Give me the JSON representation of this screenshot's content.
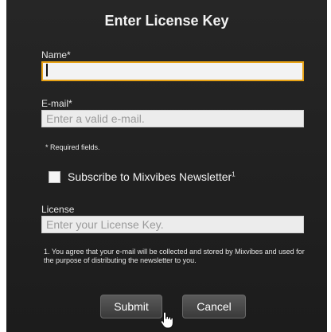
{
  "dialog": {
    "title": "Enter License Key"
  },
  "form": {
    "name": {
      "label": "Name*",
      "value": "",
      "placeholder": ""
    },
    "email": {
      "label": "E-mail*",
      "value": "",
      "placeholder": "Enter a valid e-mail."
    },
    "required_note": "* Required fields.",
    "newsletter": {
      "label": "Subscribe to Mixvibes Newsletter",
      "footnote_mark": "1",
      "checked": false
    },
    "license": {
      "label": "License",
      "value": "",
      "placeholder": "Enter your License Key."
    },
    "disclaimer": "1. You agree that your e-mail will be collected and stored by Mixvibes and used for the purpose of distributing the newsletter to you."
  },
  "buttons": {
    "submit_label": "Submit",
    "cancel_label": "Cancel"
  },
  "colors": {
    "background": "#1f1f1f",
    "focus_border": "#e8a317",
    "field_bg": "#ececec"
  },
  "icons": {
    "cursor": "hand-pointer-icon"
  }
}
